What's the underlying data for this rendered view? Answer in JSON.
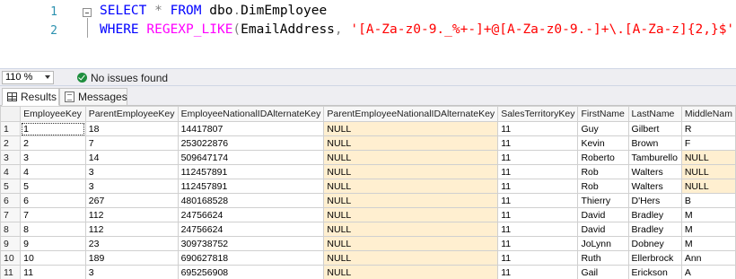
{
  "editor": {
    "line_numbers": [
      "1",
      "2"
    ],
    "line1": [
      {
        "text": "SELECT",
        "cls": "kw"
      },
      {
        "text": " ",
        "cls": "plain"
      },
      {
        "text": "*",
        "cls": "op"
      },
      {
        "text": " ",
        "cls": "plain"
      },
      {
        "text": "FROM",
        "cls": "kw"
      },
      {
        "text": " dbo",
        "cls": "plain"
      },
      {
        "text": ".",
        "cls": "op"
      },
      {
        "text": "DimEmployee",
        "cls": "plain"
      }
    ],
    "line2": [
      {
        "text": "WHERE",
        "cls": "kw"
      },
      {
        "text": " ",
        "cls": "plain"
      },
      {
        "text": "REGEXP_LIKE",
        "cls": "fn"
      },
      {
        "text": "(",
        "cls": "op"
      },
      {
        "text": "EmailAddress",
        "cls": "plain"
      },
      {
        "text": ",",
        "cls": "op"
      },
      {
        "text": " ",
        "cls": "plain"
      },
      {
        "text": "'[A-Za-z0-9._%+-]+@[A-Za-z0-9.-]+\\.[A-Za-z]{2,}$'",
        "cls": "str"
      },
      {
        "text": ");",
        "cls": "op"
      }
    ]
  },
  "statusbar": {
    "zoom": "110 %",
    "status": "No issues found"
  },
  "tabs": {
    "results": "Results",
    "messages": "Messages"
  },
  "grid": {
    "columns": [
      "EmployeeKey",
      "ParentEmployeeKey",
      "EmployeeNationalIDAlternateKey",
      "ParentEmployeeNationalIDAlternateKey",
      "SalesTerritoryKey",
      "FirstName",
      "LastName",
      "MiddleNam"
    ],
    "rows": [
      [
        "1",
        "1",
        "18",
        "14417807",
        "NULL",
        "11",
        "Guy",
        "Gilbert",
        "R"
      ],
      [
        "2",
        "2",
        "7",
        "253022876",
        "NULL",
        "11",
        "Kevin",
        "Brown",
        "F"
      ],
      [
        "3",
        "3",
        "14",
        "509647174",
        "NULL",
        "11",
        "Roberto",
        "Tamburello",
        "NULL"
      ],
      [
        "4",
        "4",
        "3",
        "112457891",
        "NULL",
        "11",
        "Rob",
        "Walters",
        "NULL"
      ],
      [
        "5",
        "5",
        "3",
        "112457891",
        "NULL",
        "11",
        "Rob",
        "Walters",
        "NULL"
      ],
      [
        "6",
        "6",
        "267",
        "480168528",
        "NULL",
        "11",
        "Thierry",
        "D'Hers",
        "B"
      ],
      [
        "7",
        "7",
        "112",
        "24756624",
        "NULL",
        "11",
        "David",
        "Bradley",
        "M"
      ],
      [
        "8",
        "8",
        "112",
        "24756624",
        "NULL",
        "11",
        "David",
        "Bradley",
        "M"
      ],
      [
        "9",
        "9",
        "23",
        "309738752",
        "NULL",
        "11",
        "JoLynn",
        "Dobney",
        "M"
      ],
      [
        "10",
        "10",
        "189",
        "690627818",
        "NULL",
        "11",
        "Ruth",
        "Ellerbrock",
        "Ann"
      ],
      [
        "11",
        "11",
        "3",
        "695256908",
        "NULL",
        "11",
        "Gail",
        "Erickson",
        "A"
      ]
    ]
  },
  "colors": {
    "keyword": "#0000ff",
    "function": "#ff00ff",
    "string": "#ff0000",
    "null_cell": "#ffefd0",
    "line_number": "#2b91af"
  }
}
